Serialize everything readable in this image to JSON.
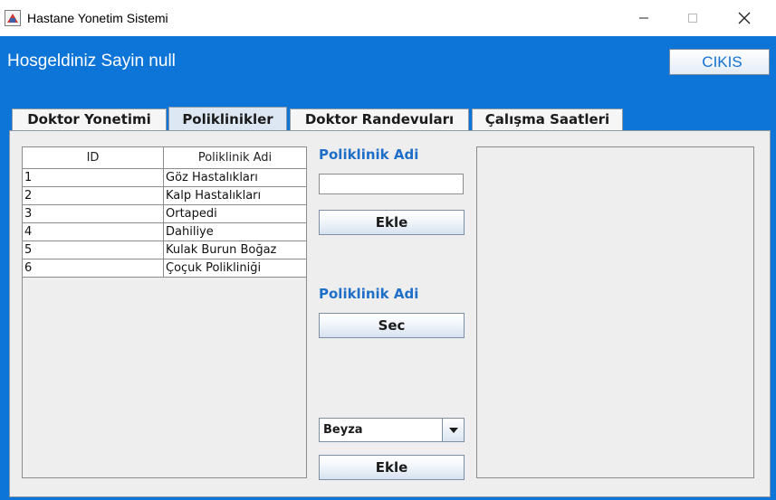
{
  "window": {
    "title": "Hastane Yonetim Sistemi",
    "icon": "app-icon",
    "controls": [
      "minimize-icon",
      "maximize-icon",
      "close-icon"
    ]
  },
  "header": {
    "welcome": "Hosgeldiniz Sayin null",
    "exit_label": "CIKIS"
  },
  "tabs": [
    {
      "label": "Doktor Yonetimi",
      "active": false
    },
    {
      "label": "Poliklinikler",
      "active": true
    },
    {
      "label": "Doktor Randevuları",
      "active": false
    },
    {
      "label": "Çalışma Saatleri",
      "active": false
    }
  ],
  "table": {
    "columns": [
      "ID",
      "Poliklinik Adi"
    ],
    "rows": [
      {
        "id": "1",
        "name": "Göz Hastalıkları"
      },
      {
        "id": "2",
        "name": "Kalp Hastalıkları"
      },
      {
        "id": "3",
        "name": "Ortapedi"
      },
      {
        "id": "4",
        "name": "Dahiliye"
      },
      {
        "id": "5",
        "name": "Kulak Burun Boğaz"
      },
      {
        "id": "6",
        "name": "Çoçuk Polikliniği"
      }
    ]
  },
  "form": {
    "add_label": "Poliklinik Adi",
    "name_input_value": "",
    "add_button": "Ekle",
    "select_label": "Poliklinik Adi",
    "select_button": "Sec",
    "doctor_select_value": "Beyza",
    "doctor_add_button": "Ekle"
  },
  "colors": {
    "window_bg": "#0d74d8",
    "label_blue": "#1f6fc8",
    "panel_bg": "#eeeeee"
  }
}
